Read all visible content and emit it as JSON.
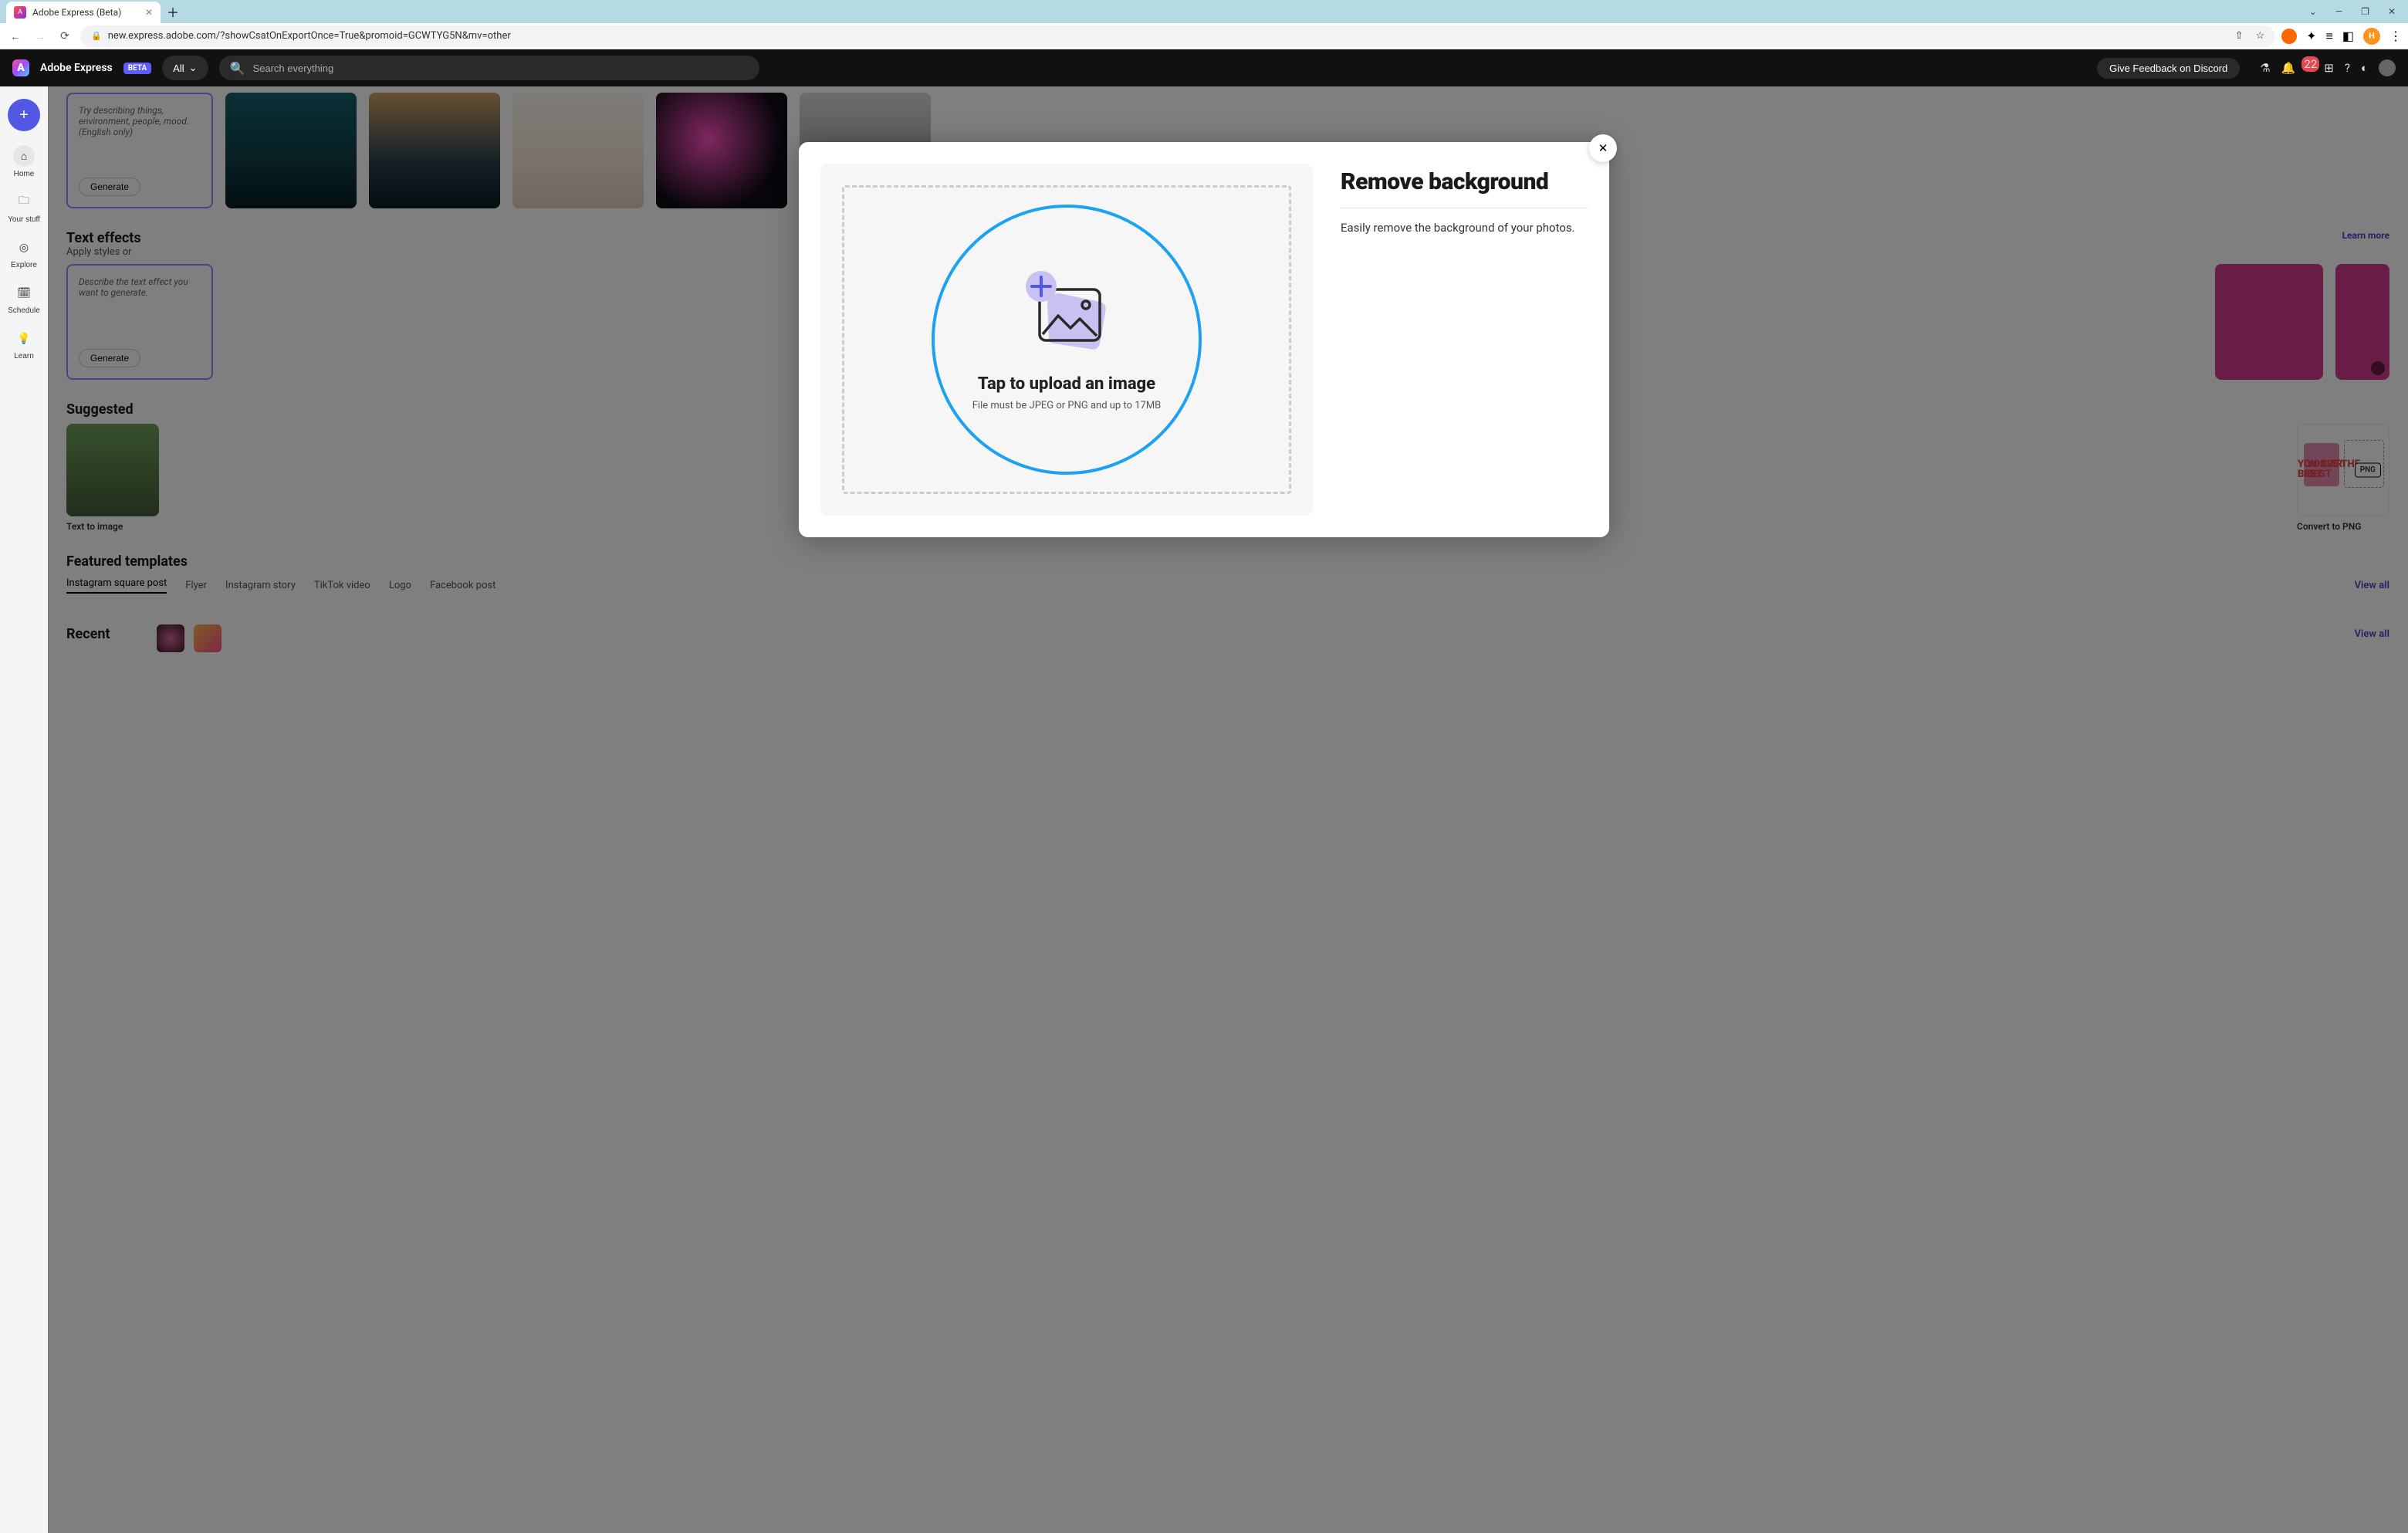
{
  "browser": {
    "tab_title": "Adobe Express (Beta)",
    "url": "new.express.adobe.com/?showCsatOnExportOnce=True&promoid=GCWTYG5N&mv=other",
    "profile_letter": "H"
  },
  "app_header": {
    "brand": "Adobe Express",
    "beta": "BETA",
    "filter_label": "All",
    "search_placeholder": "Search everything",
    "feedback_label": "Give Feedback on Discord",
    "notification_count": "22"
  },
  "rail": {
    "items": [
      "Home",
      "Your stuff",
      "Explore",
      "Schedule",
      "Learn"
    ]
  },
  "prompt_card_a": {
    "text": "Try describing things, environment, people, mood. (English only)",
    "button": "Generate"
  },
  "prompt_card_b": {
    "text": "Describe the text effect you want to generate.",
    "button": "Generate"
  },
  "sections": {
    "text_effects_title": "Text effects",
    "text_effects_sub": "Apply styles or",
    "learn_more": "Learn more",
    "suggested_title": "Suggested",
    "featured_title": "Featured templates",
    "recent_title": "Recent",
    "view_all": "View all"
  },
  "suggested": {
    "left_label": "Text to image",
    "right_label": "Convert to PNG",
    "png_badge": "PNG",
    "best_a": "YOU\nARE THE\nBEST",
    "best_b": "YOU\nARE THE\nBEST"
  },
  "template_tabs": [
    "Instagram square post",
    "Flyer",
    "Instagram story",
    "TikTok video",
    "Logo",
    "Facebook post"
  ],
  "modal": {
    "title": "Remove background",
    "description": "Easily remove the background of your photos.",
    "drop_title": "Tap to upload an image",
    "drop_sub": "File must be JPEG or PNG and up to 17MB"
  }
}
